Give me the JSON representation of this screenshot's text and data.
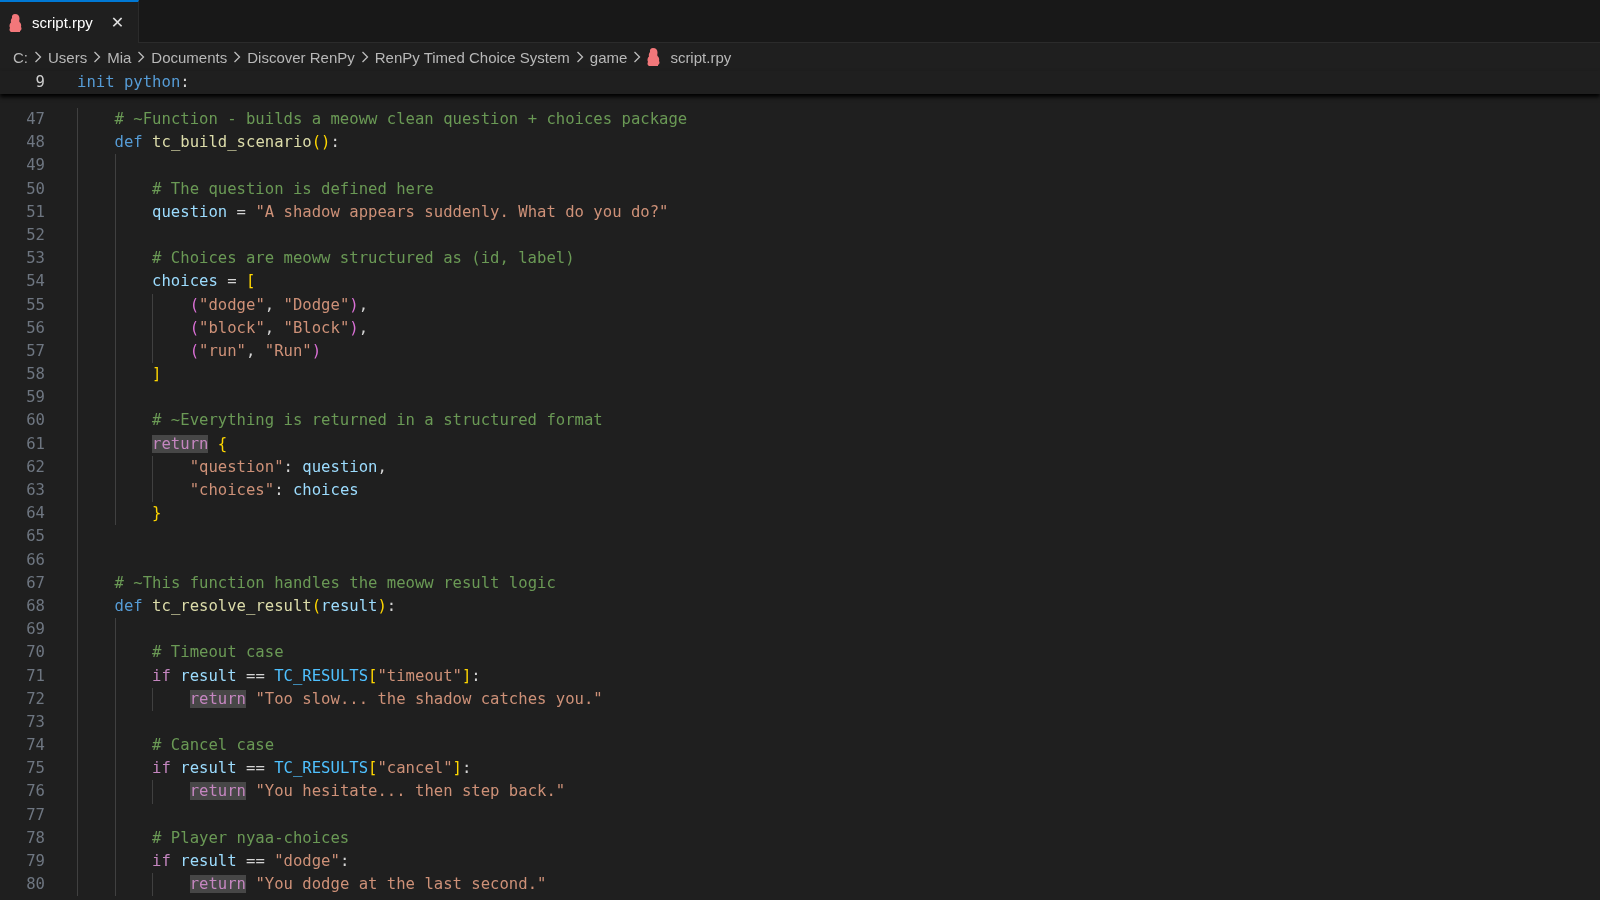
{
  "tabs": [
    {
      "label": "script.rpy",
      "selected": true,
      "close": "✕"
    }
  ],
  "breadcrumbs": [
    "C:",
    "Users",
    "Mia",
    "Documents",
    "Discover RenPy",
    "RenPy Timed Choice System",
    "game",
    "script.rpy"
  ],
  "sticky_line": {
    "number": "9",
    "tokens": [
      {
        "kind": "keyword",
        "text": "init "
      },
      {
        "kind": "keyword",
        "text": "python"
      },
      {
        "kind": "plain",
        "text": ":"
      }
    ]
  },
  "lines": [
    {
      "number": "47",
      "tokens": [
        {
          "kind": "comment",
          "text": "# ~Function - builds a meoww clean question + choices package"
        }
      ]
    },
    {
      "number": "48",
      "tokens": [
        {
          "kind": "keyword",
          "text": "def "
        },
        {
          "kind": "function",
          "text": "tc_build_scenario"
        },
        {
          "kind": "bracket",
          "text": "()"
        },
        {
          "kind": "plain",
          "text": ":"
        }
      ],
      "children": [
        {
          "number": "49"
        },
        {
          "number": "50",
          "tokens": [
            {
              "kind": "comment",
              "text": "# The question is defined here"
            }
          ]
        },
        {
          "number": "51",
          "tokens": [
            {
              "kind": "variable",
              "text": "question"
            },
            {
              "kind": "plain",
              "text": " = "
            },
            {
              "kind": "string",
              "text": "\"A shadow appears suddenly. What do you do?\""
            }
          ]
        },
        {
          "number": "52"
        },
        {
          "number": "53",
          "tokens": [
            {
              "kind": "comment",
              "text": "# Choices are meoww structured as (id, label)"
            }
          ]
        },
        {
          "number": "54",
          "tokens": [
            {
              "kind": "variable",
              "text": "choices"
            },
            {
              "kind": "plain",
              "text": " = "
            },
            {
              "kind": "bracket",
              "text": "["
            }
          ],
          "children": [
            {
              "number": "55",
              "tokens": [
                {
                  "kind": "bracket2",
                  "text": "("
                },
                {
                  "kind": "string",
                  "text": "\"dodge\""
                },
                {
                  "kind": "plain",
                  "text": ", "
                },
                {
                  "kind": "string",
                  "text": "\"Dodge\""
                },
                {
                  "kind": "bracket2",
                  "text": ")"
                },
                {
                  "kind": "plain",
                  "text": ","
                }
              ]
            },
            {
              "number": "56",
              "tokens": [
                {
                  "kind": "bracket2",
                  "text": "("
                },
                {
                  "kind": "string",
                  "text": "\"block\""
                },
                {
                  "kind": "plain",
                  "text": ", "
                },
                {
                  "kind": "string",
                  "text": "\"Block\""
                },
                {
                  "kind": "bracket2",
                  "text": ")"
                },
                {
                  "kind": "plain",
                  "text": ","
                }
              ]
            },
            {
              "number": "57",
              "tokens": [
                {
                  "kind": "bracket2",
                  "text": "("
                },
                {
                  "kind": "string",
                  "text": "\"run\""
                },
                {
                  "kind": "plain",
                  "text": ", "
                },
                {
                  "kind": "string",
                  "text": "\"Run\""
                },
                {
                  "kind": "bracket2",
                  "text": ")"
                }
              ]
            }
          ]
        },
        {
          "number": "58",
          "tokens": [
            {
              "kind": "bracket",
              "text": "]"
            }
          ]
        },
        {
          "number": "59"
        },
        {
          "number": "60",
          "tokens": [
            {
              "kind": "comment",
              "text": "# ~Everything is returned in a structured format"
            }
          ]
        },
        {
          "number": "61",
          "tokens": [
            {
              "kind": "control-highlighted",
              "text": "return"
            },
            {
              "kind": "bracket",
              "text": " {"
            }
          ],
          "children": [
            {
              "number": "62",
              "tokens": [
                {
                  "kind": "string",
                  "text": "\"question\""
                },
                {
                  "kind": "plain",
                  "text": ": "
                },
                {
                  "kind": "variable",
                  "text": "question"
                },
                {
                  "kind": "plain",
                  "text": ","
                }
              ]
            },
            {
              "number": "63",
              "tokens": [
                {
                  "kind": "string",
                  "text": "\"choices\""
                },
                {
                  "kind": "plain",
                  "text": ": "
                },
                {
                  "kind": "variable",
                  "text": "choices"
                }
              ]
            }
          ]
        },
        {
          "number": "64",
          "tokens": [
            {
              "kind": "bracket",
              "text": "}"
            }
          ]
        }
      ]
    },
    {
      "number": "65"
    },
    {
      "number": "66"
    },
    {
      "number": "67",
      "tokens": [
        {
          "kind": "comment",
          "text": "# ~This function handles the meoww result logic"
        }
      ]
    },
    {
      "number": "68",
      "tokens": [
        {
          "kind": "keyword",
          "text": "def "
        },
        {
          "kind": "function",
          "text": "tc_resolve_result"
        },
        {
          "kind": "bracket",
          "text": "("
        },
        {
          "kind": "variable",
          "text": "result"
        },
        {
          "kind": "bracket",
          "text": ")"
        },
        {
          "kind": "plain",
          "text": ":"
        }
      ],
      "children": [
        {
          "number": "69"
        },
        {
          "number": "70",
          "tokens": [
            {
              "kind": "comment",
              "text": "# Timeout case"
            }
          ]
        },
        {
          "number": "71",
          "tokens": [
            {
              "kind": "control",
              "text": "if "
            },
            {
              "kind": "variable",
              "text": "result"
            },
            {
              "kind": "plain",
              "text": " == "
            },
            {
              "kind": "constant",
              "text": "TC_RESULTS"
            },
            {
              "kind": "bracket",
              "text": "["
            },
            {
              "kind": "string",
              "text": "\"timeout\""
            },
            {
              "kind": "bracket",
              "text": "]"
            },
            {
              "kind": "plain",
              "text": ":"
            }
          ],
          "children": [
            {
              "number": "72",
              "tokens": [
                {
                  "kind": "control-highlighted",
                  "text": "return"
                },
                {
                  "kind": "string",
                  "text": " \"Too slow... the shadow catches you.\""
                }
              ]
            }
          ]
        },
        {
          "number": "73"
        },
        {
          "number": "74",
          "tokens": [
            {
              "kind": "comment",
              "text": "# Cancel case"
            }
          ]
        },
        {
          "number": "75",
          "tokens": [
            {
              "kind": "control",
              "text": "if "
            },
            {
              "kind": "variable",
              "text": "result"
            },
            {
              "kind": "plain",
              "text": " == "
            },
            {
              "kind": "constant",
              "text": "TC_RESULTS"
            },
            {
              "kind": "bracket",
              "text": "["
            },
            {
              "kind": "string",
              "text": "\"cancel\""
            },
            {
              "kind": "bracket",
              "text": "]"
            },
            {
              "kind": "plain",
              "text": ":"
            }
          ],
          "children": [
            {
              "number": "76",
              "tokens": [
                {
                  "kind": "control-highlighted",
                  "text": "return"
                },
                {
                  "kind": "string",
                  "text": " \"You hesitate... then step back.\""
                }
              ]
            }
          ]
        },
        {
          "number": "77"
        },
        {
          "number": "78",
          "tokens": [
            {
              "kind": "comment",
              "text": "# Player nyaa-choices"
            }
          ]
        },
        {
          "number": "79",
          "tokens": [
            {
              "kind": "control",
              "text": "if "
            },
            {
              "kind": "variable",
              "text": "result"
            },
            {
              "kind": "plain",
              "text": " == "
            },
            {
              "kind": "string",
              "text": "\"dodge\""
            },
            {
              "kind": "plain",
              "text": ":"
            }
          ],
          "children": [
            {
              "number": "80",
              "tokens": [
                {
                  "kind": "control-highlighted",
                  "text": "return"
                },
                {
                  "kind": "string",
                  "text": " \"You dodge at the last second.\""
                }
              ]
            }
          ]
        }
      ]
    }
  ]
}
